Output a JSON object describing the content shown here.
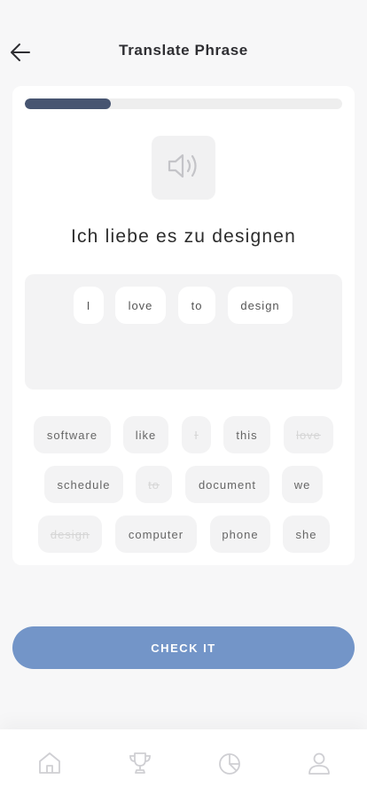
{
  "header": {
    "title": "Translate Phrase"
  },
  "lesson": {
    "progress": 0.27,
    "phrase": "Ich liebe es zu designen"
  },
  "answer": {
    "words": [
      "I",
      "love",
      "to",
      "design"
    ]
  },
  "word_bank": [
    {
      "label": "software",
      "used": false
    },
    {
      "label": "like",
      "used": false
    },
    {
      "label": "I",
      "used": true
    },
    {
      "label": "this",
      "used": false
    },
    {
      "label": "love",
      "used": true
    },
    {
      "label": "schedule",
      "used": false
    },
    {
      "label": "to",
      "used": true
    },
    {
      "label": "document",
      "used": false
    },
    {
      "label": "we",
      "used": false
    },
    {
      "label": "design",
      "used": true
    },
    {
      "label": "computer",
      "used": false
    },
    {
      "label": "phone",
      "used": false
    },
    {
      "label": "she",
      "used": false
    }
  ],
  "actions": {
    "check_label": "CHECK IT"
  },
  "tabs": [
    {
      "icon": "home-icon"
    },
    {
      "icon": "trophy-icon"
    },
    {
      "icon": "pie-chart-icon"
    },
    {
      "icon": "profile-icon"
    }
  ],
  "colors": {
    "accent": "#7395c8",
    "progress": "#475571",
    "chip_background": "#f3f3f4",
    "used_word": "#d6d6d6"
  }
}
